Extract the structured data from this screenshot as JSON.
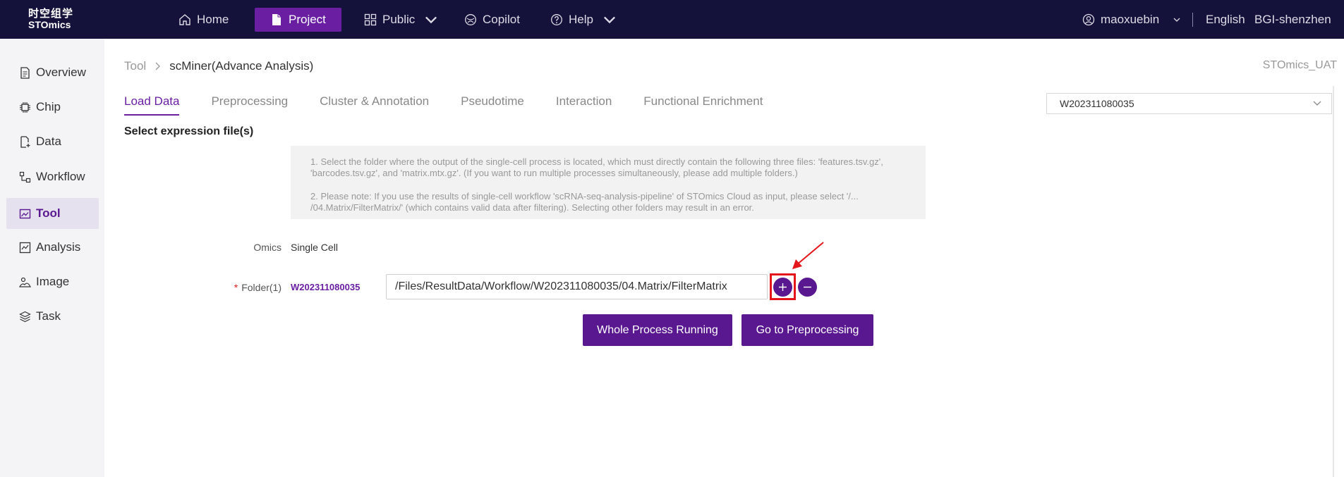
{
  "topbar": {
    "logo_cn": "时空组学",
    "logo_en": "STOmics",
    "nav": [
      {
        "label": "Home",
        "icon": "home-icon"
      },
      {
        "label": "Project",
        "icon": "project-icon",
        "active": true
      },
      {
        "label": "Public",
        "icon": "grid-icon",
        "dropdown": true
      },
      {
        "label": "Copilot",
        "icon": "copilot-icon"
      },
      {
        "label": "Help",
        "icon": "help-icon",
        "dropdown": true
      }
    ],
    "user": "maoxuebin",
    "language": "English",
    "org": "BGI-shenzhen"
  },
  "sidebar": {
    "items": [
      {
        "label": "Overview",
        "icon": "document-icon"
      },
      {
        "label": "Chip",
        "icon": "chip-icon"
      },
      {
        "label": "Data",
        "icon": "data-icon"
      },
      {
        "label": "Workflow",
        "icon": "workflow-icon"
      },
      {
        "label": "Tool",
        "icon": "tool-icon",
        "active": true
      },
      {
        "label": "Analysis",
        "icon": "analysis-icon"
      },
      {
        "label": "Image",
        "icon": "image-icon"
      },
      {
        "label": "Task",
        "icon": "layers-icon"
      }
    ]
  },
  "breadcrumb": {
    "root": "Tool",
    "current": "scMiner(Advance Analysis)"
  },
  "env_label": "STOmics_UAT",
  "tabs": [
    "Load Data",
    "Preprocessing",
    "Cluster & Annotation",
    "Pseudotime",
    "Interaction",
    "Functional Enrichment"
  ],
  "active_tab": "Load Data",
  "project_select": "W202311080035",
  "section_title": "Select expression file(s)",
  "notice": {
    "p1": "1. Select the folder where the output of the single-cell process is located, which must directly contain the following three files: 'features.tsv.gz', 'barcodes.tsv.gz', and 'matrix.mtx.gz'. (If you want to run multiple processes simultaneously, please add multiple folders.)",
    "p2": "2. Please note: If you use the results of single-cell workflow 'scRNA-seq-analysis-pipeline' of STOmics Cloud as input, please select '/... /04.Matrix/FilterMatrix/' (which contains valid data after filtering). Selecting other folders may result in an error."
  },
  "form": {
    "omics_label": "Omics",
    "omics_value": "Single Cell",
    "required_mark": "*",
    "folder_label": "Folder(1)",
    "folder_tag": "W202311080035",
    "folder_path": "/Files/ResultData/Workflow/W202311080035/04.Matrix/FilterMatrix"
  },
  "actions": {
    "run_all": "Whole Process Running",
    "next": "Go to Preprocessing"
  },
  "colors": {
    "nav_bg": "#14113b",
    "accent": "#6a1fa3",
    "button": "#5a1890",
    "highlight": "#e4161c"
  }
}
